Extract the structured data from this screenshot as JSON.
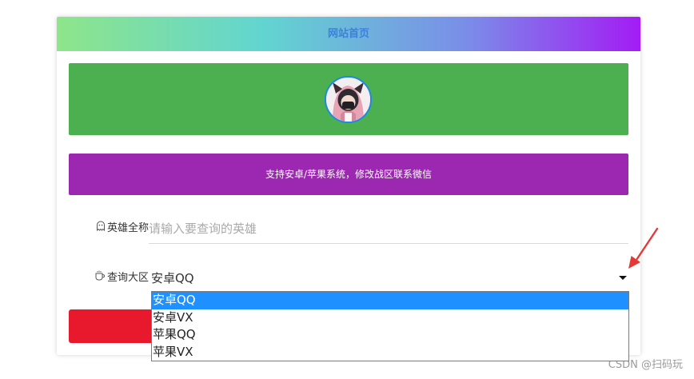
{
  "header": {
    "title": "网站首页"
  },
  "banner": {
    "notice": "支持安卓/苹果系统，修改战区联系微信"
  },
  "form": {
    "hero": {
      "label": "英雄全称",
      "placeholder": "请输入要查询的英雄",
      "value": ""
    },
    "zone": {
      "label": "查询大区",
      "selected": "安卓QQ",
      "options": [
        "安卓QQ",
        "安卓VX",
        "苹果QQ",
        "苹果VX"
      ]
    }
  },
  "colors": {
    "header_title": "#3d7fe0",
    "green_banner": "#4caf50",
    "purple_banner": "#9c27b0",
    "red_button": "#e8192c",
    "option_highlight": "#1e90ff",
    "annotation_arrow": "#e53935"
  },
  "icons": {
    "hero_label_icon": "ghost-icon",
    "zone_label_icon": "cup-icon",
    "select_caret": "caret-down-icon"
  },
  "watermark": "CSDN @扫码玩"
}
